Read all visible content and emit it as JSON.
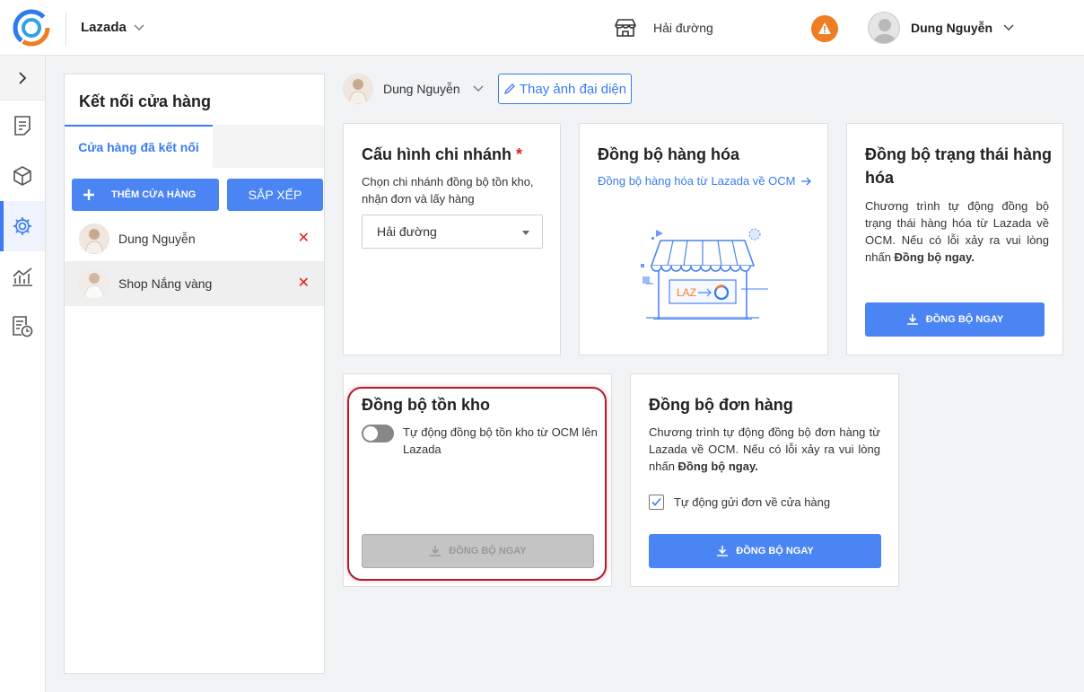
{
  "header": {
    "store_name": "Lazada",
    "branch": "Hải đường",
    "user_name": "Dung Nguyễn"
  },
  "left_panel": {
    "title": "Kết nối cửa hàng",
    "tab_connected": "Cửa hàng đã kết nối",
    "add_button": "THÊM CỬA HÀNG",
    "sort_button": "SẮP XẾP",
    "shops": [
      {
        "name": "Dung Nguyễn",
        "remove": "✕"
      },
      {
        "name": "Shop Nắng vàng",
        "remove": "✕"
      }
    ]
  },
  "profile": {
    "name": "Dung Nguyễn",
    "change_avatar": "Thay ảnh đại diện"
  },
  "cards": {
    "branch_config": {
      "title": "Cấu hình chi nhánh",
      "required_mark": "*",
      "desc": "Chọn chi nhánh đồng bộ tồn kho, nhận đơn và lấy hàng",
      "selected": "Hải đường"
    },
    "product_sync": {
      "title": "Đồng bộ hàng hóa",
      "link": "Đồng bộ hàng hóa từ Lazada về OCM",
      "illustration_text": "LAZ"
    },
    "status_sync": {
      "title": "Đồng bộ trạng thái hàng hóa",
      "desc": "Chương trình tự động đồng bộ trạng thái hàng hóa từ Lazada về OCM. Nếu có lỗi xảy ra vui lòng nhấn",
      "desc_bold": "Đồng bộ ngay.",
      "button": "ĐỒNG BỘ NGAY"
    },
    "stock_sync": {
      "title": "Đồng bộ tồn kho",
      "toggle_label": "Tự động đồng bộ tồn kho từ OCM lên Lazada",
      "button": "ĐỒNG BỘ NGAY"
    },
    "order_sync": {
      "title": "Đồng bộ đơn hàng",
      "desc": "Chương trình tự động đồng bộ đơn hàng từ Lazada về OCM. Nếu có lỗi xảy ra vui lòng nhấn",
      "desc_bold": "Đồng bộ ngay.",
      "checkbox_label": "Tự động gửi đơn về cửa hàng",
      "button": "ĐỒNG BỘ NGAY"
    }
  },
  "colors": {
    "accent": "#4b84f3",
    "warning": "#f07d21",
    "danger": "#e02020",
    "highlight": "#b31b2b"
  },
  "icons": [
    "app-logo-icon",
    "chevron-down-icon",
    "store-icon",
    "warning-icon",
    "chevron-right-icon",
    "document-icon",
    "box-icon",
    "gear-icon",
    "chart-icon",
    "report-clock-icon",
    "plus-icon",
    "close-icon",
    "pencil-icon",
    "arrow-right-icon",
    "download-icon",
    "check-icon"
  ]
}
